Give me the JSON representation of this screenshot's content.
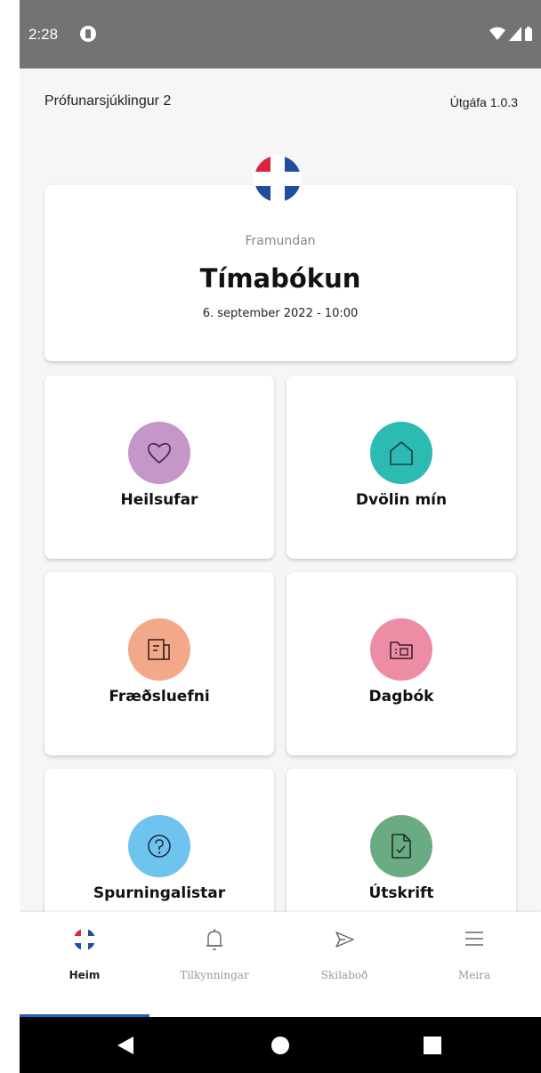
{
  "status_bar": {
    "time": "2:28"
  },
  "header": {
    "patient_name": "Prófunarsjúklingur 2",
    "version": "Útgáfa 1.0.3"
  },
  "appointment": {
    "upcoming_label": "Framundan",
    "title": "Tímabókun",
    "datetime": "6. september 2022 - 10:00"
  },
  "tiles": [
    {
      "label": "Heilsufar",
      "icon": "heart-icon",
      "color": "#c597c9"
    },
    {
      "label": "Dvölin mín",
      "icon": "house-icon",
      "color": "#2bbbb3"
    },
    {
      "label": "Fræðsluefni",
      "icon": "document-icon",
      "color": "#f4a88a"
    },
    {
      "label": "Dagbók",
      "icon": "folder-icon",
      "color": "#ec8da5"
    },
    {
      "label": "Spurningalistar",
      "icon": "question-icon",
      "color": "#6ec4ef"
    },
    {
      "label": "Útskrift",
      "icon": "file-check-icon",
      "color": "#6aab84"
    }
  ],
  "bottom_nav": {
    "items": [
      {
        "label": "Heim",
        "icon": "home-logo-icon",
        "active": true
      },
      {
        "label": "Tilkynningar",
        "icon": "bell-icon",
        "active": false
      },
      {
        "label": "Skilaboð",
        "icon": "send-icon",
        "active": false
      },
      {
        "label": "Meira",
        "icon": "menu-icon",
        "active": false
      }
    ]
  },
  "colors": {
    "accent": "#1f63c6",
    "logo_blue": "#1f4f9c",
    "logo_red": "#d9263c"
  }
}
